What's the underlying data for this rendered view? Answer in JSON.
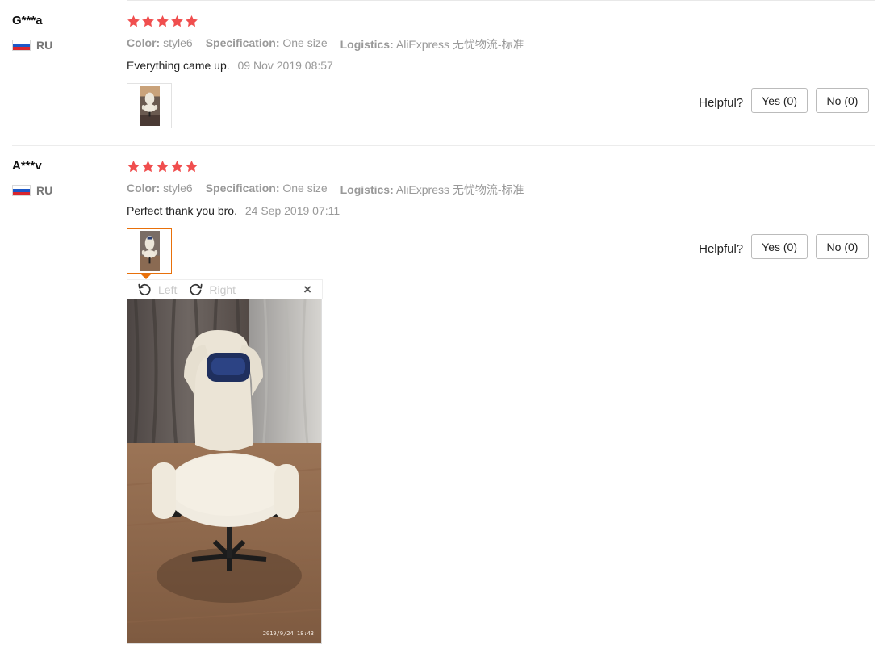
{
  "reviews": [
    {
      "user": "G***a",
      "country": "RU",
      "stars": 5,
      "attributes": [
        {
          "key": "Color:",
          "value": "style6"
        },
        {
          "key": "Specification:",
          "value": "One size"
        },
        {
          "key": "Logistics:",
          "value": "AliExpress 无忧物流-标准"
        }
      ],
      "text": "Everything came up.",
      "date": "09 Nov 2019 08:57",
      "helpful_label": "Helpful?",
      "yes_label": "Yes (0)",
      "no_label": "No (0)"
    },
    {
      "user": "A***v",
      "country": "RU",
      "stars": 5,
      "attributes": [
        {
          "key": "Color:",
          "value": "style6"
        },
        {
          "key": "Specification:",
          "value": "One size"
        },
        {
          "key": "Logistics:",
          "value": "AliExpress 无忧物流-标准"
        }
      ],
      "text": "Perfect thank you bro.",
      "date": "24 Sep 2019 07:11",
      "helpful_label": "Helpful?",
      "yes_label": "Yes (0)",
      "no_label": "No (0)"
    }
  ],
  "viewer": {
    "rotate_left_label": "Left",
    "rotate_right_label": "Right",
    "close_symbol": "×",
    "photo_timestamp": "2019/9/24  18:43"
  },
  "colors": {
    "star": "#f04e4e",
    "accent": "#e8700a",
    "muted_text": "#999999"
  },
  "icons": {
    "flag": "russia-flag-icon",
    "star": "star-icon",
    "rotate_left": "rotate-left-icon",
    "rotate_right": "rotate-right-icon",
    "close": "close-icon"
  }
}
